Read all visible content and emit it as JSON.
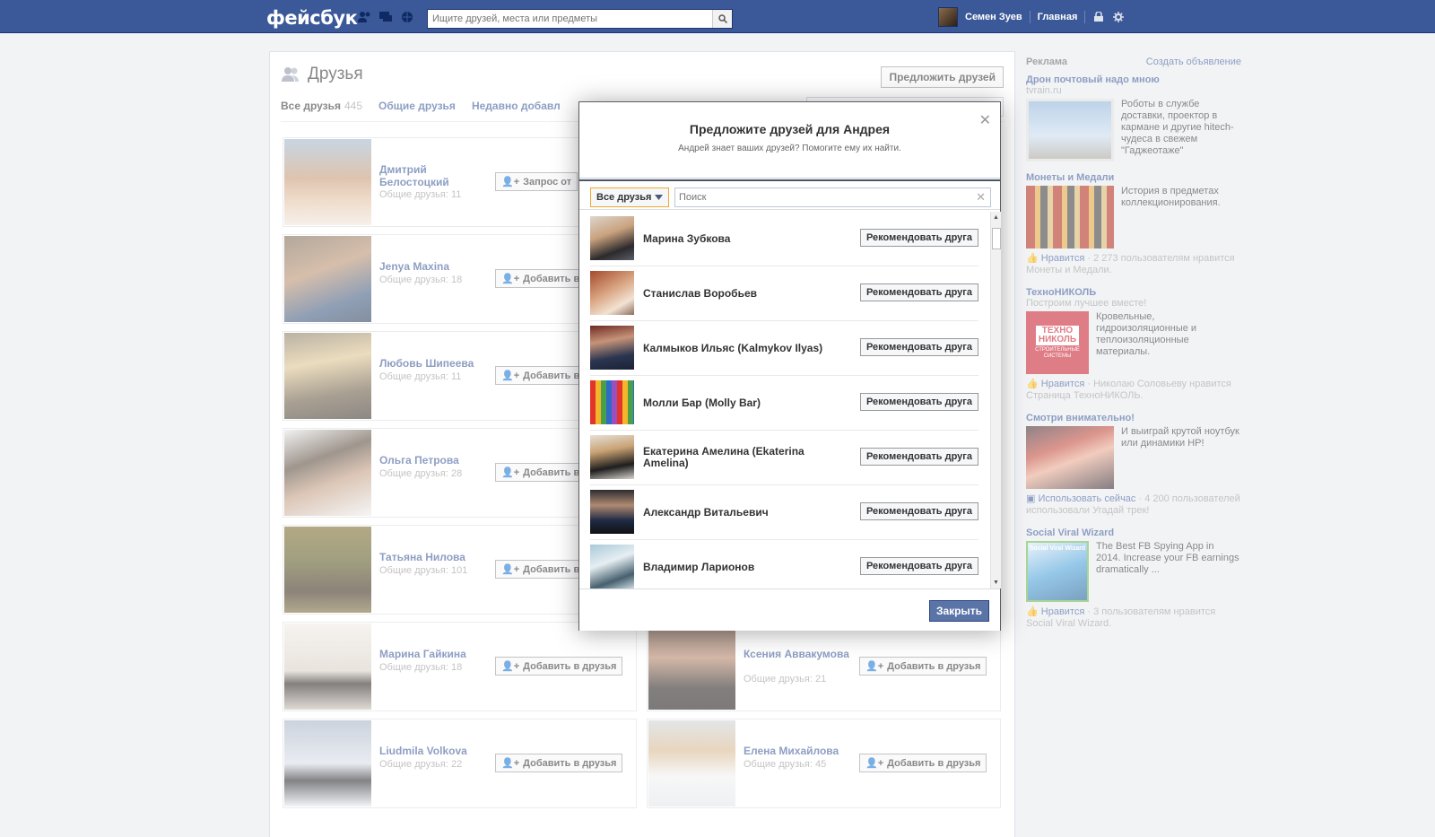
{
  "topbar": {
    "logo": "фейсбук",
    "search_placeholder": "Ищите друзей, места или предметы",
    "user_name": "Семен Зуев",
    "home_label": "Главная"
  },
  "page": {
    "title": "Друзья",
    "suggest_button": "Предложить друзей",
    "tabs": [
      {
        "label": "Все друзья",
        "count": "445"
      },
      {
        "label": "Общие друзья"
      },
      {
        "label": "Недавно добавл"
      }
    ]
  },
  "friends": [
    {
      "name": "Дмитрий Белостоцкий",
      "mutual": "Общие друзья: 11",
      "button": "Запрос от"
    },
    {
      "name": "Jenya Maxina",
      "mutual": "Общие друзья: 18",
      "button": "Добавить в"
    },
    {
      "name": "Любовь Шипеева",
      "mutual": "Общие друзья: 11",
      "button": "Добавить в"
    },
    {
      "name": "Ольга Петрова",
      "mutual": "Общие друзья: 28",
      "button": "Добавить в"
    },
    {
      "name": "Татьяна Нилова",
      "mutual": "Общие друзья: 101",
      "button": "Добавить в"
    },
    {
      "name": "Марина Гайкина",
      "mutual": "Общие друзья: 18",
      "button": "Добавить в друзья"
    },
    {
      "name": "Ксения Аввакумова",
      "mutual": "Общие друзья: 21",
      "button": "Добавить в друзья"
    },
    {
      "name": "Liudmila Volkova",
      "mutual": "Общие друзья: 22",
      "button": "Добавить в друзья"
    },
    {
      "name": "Елена Михайлова",
      "mutual": "Общие друзья: 45",
      "button": "Добавить в друзья"
    }
  ],
  "ads": {
    "header": "Реклама",
    "create_link": "Создать объявление",
    "items": [
      {
        "title": "Дрон почтовый надо мною",
        "sub": "tvrain.ru",
        "text": "Роботы в службе доставки, проектор в кармане и другие hitech-чудеса в свежем \"Гаджеотаже\""
      },
      {
        "title": "Монеты и Медали",
        "text": "История в предметах коллекционирования.",
        "like_label": "Нравится",
        "like_text": " · 2 273 пользователям нравится Монеты и Медали."
      },
      {
        "title": "ТехноНИКОЛЬ",
        "sub": "Построим лучшее вместе!",
        "text": "Кровельные, гидроизоляционные и теплоизоляционные материалы.",
        "like_label": "Нравится",
        "like_text": " · Николаю Соловьеву нравится Страница ТехноНИКОЛЬ.",
        "logo_line1": "ТЕХНО",
        "logo_line2": "НИКОЛЬ",
        "logo_line3": "СТРОИТЕЛЬНЫЕ СИСТЕМЫ"
      },
      {
        "title": "Смотри внимательно!",
        "text": "И выиграй крутой ноутбук или динамики HP!",
        "like_label": "Использовать сейчас",
        "like_text": " · 4 200 пользователей использовали Угадай трек!"
      },
      {
        "title": "Social Viral Wizard",
        "text": "The Best FB Spying App in 2014. Increase your FB earnings dramatically ...",
        "like_label": "Нравится",
        "like_text": " · 3 пользователям нравится Social Viral Wizard.",
        "logo_text": "Social Viral Wizard"
      }
    ]
  },
  "dialog": {
    "title": "Предложите друзей для Андрея",
    "subtitle": "Андрей знает ваших друзей? Помогите ему их найти.",
    "filter_label": "Все друзья",
    "search_placeholder": "Поиск",
    "recommend_label": "Рекомендовать друга",
    "close_button": "Закрыть",
    "people": [
      {
        "name": "Марина Зубкова"
      },
      {
        "name": "Станислав Воробьев"
      },
      {
        "name": "Калмыков Ильяс (Kalmykov Ilyas)"
      },
      {
        "name": "Молли Бар (Molly Bar)"
      },
      {
        "name": "Екатерина Амелина (Ekaterina Amelina)"
      },
      {
        "name": "Александр Витальевич"
      },
      {
        "name": "Владимир Ларионов"
      }
    ]
  },
  "colors": {
    "brand": "#3b5998",
    "link": "#3b5998",
    "highlight_border": "#f0a830"
  }
}
